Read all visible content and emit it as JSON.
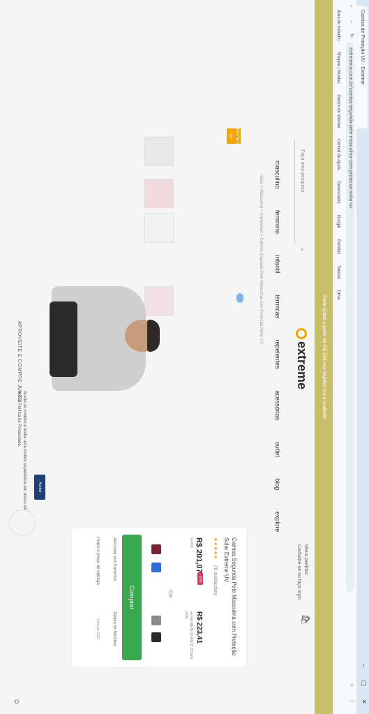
{
  "browser": {
    "tab_title": "Camisa de Proteção UV - Extreme",
    "window_controls": "– ▢ ✕",
    "nav_icons": "← → ↻",
    "url": "extremeuv.com.br/camisa-segunda-pele-masculina-com-protecao-solar-uv",
    "right_icons": "☆ ⋮",
    "bookmarks": [
      "Área de trabalho",
      "Shopee | Vendas",
      "Gestor de Vendas",
      "Central de Ajuda",
      "Gerenciador",
      "Google",
      "Pedidos",
      "Tarefas",
      "Drive"
    ]
  },
  "promo_text": "Frete grátis a partir de R$ 299 nas regiões Sul e Sudeste",
  "header": {
    "logo_text": "extreme",
    "search_placeholder": "Faça uma pesquisa",
    "account_line1": "Meus pedidos",
    "account_line2": "Cadastre-se ou faça login",
    "cart_icon": "🛍",
    "menu": [
      "masculino",
      "feminino",
      "infantil",
      "térmicas",
      "repelentes",
      "acessórios",
      "outlet",
      "blog",
      "explore"
    ]
  },
  "breadcrumb": "Início > Masculino > Camisetas > Camisa Segunda Pele Masculina com Proteção Solar UV",
  "badge": "PROTEÇÃO UV SOLAR",
  "product": {
    "name": "Camisa Segunda Pele Masculina com Proteção Solar Extreme UV",
    "stars": "★★★★★",
    "reviews": "76 avaliações",
    "price": "R$ 201,07",
    "discount": "-10%",
    "price_sub": "no PIX",
    "price_old": "R$ 223,41",
    "installments": "ou em até 6x de R$ 37,23 sem juros",
    "color_label": "Cor:",
    "colors": [
      "#7a2333",
      "#2f6fd1",
      "#8b8b8b",
      "#2a2a2a"
    ],
    "buy_label": "Comprar",
    "favorite_label": "Adicionar aos Favoritos",
    "size_label": "Tabela de Medidas",
    "shipping_label": "Prazo e preço de entrega",
    "shipping_tag": "Calcular CEP"
  },
  "bottom_cta": "APROVEITE E COMPRE JUNTO",
  "cookie": {
    "text": "Aceite os cookies e tenha uma melhor experiência em nosso site, consulte nossa Política de Privacidade.",
    "button": "Aceitar"
  }
}
